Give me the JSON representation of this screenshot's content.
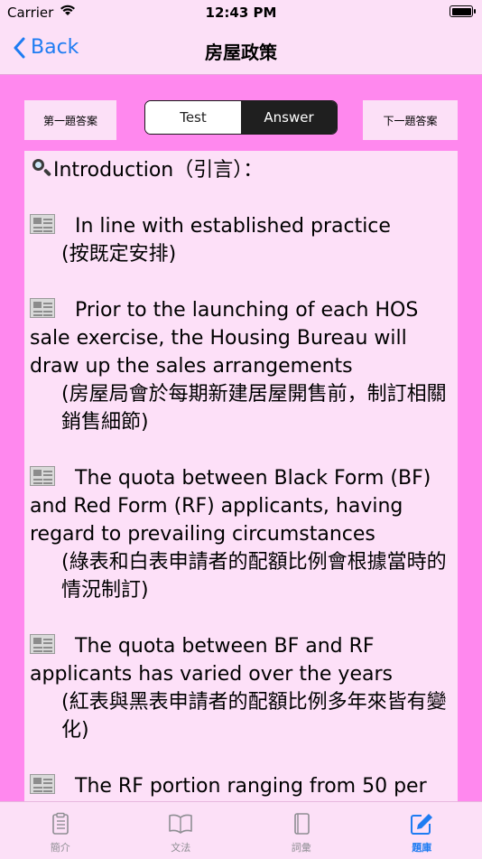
{
  "status": {
    "carrier": "Carrier",
    "time": "12:43 PM",
    "battery_level": 1.0
  },
  "nav": {
    "back_label": "Back",
    "title": "房屋政策"
  },
  "controls": {
    "prev_label": "第一題答案",
    "next_label": "下一題答案",
    "segments": [
      "Test",
      "Answer"
    ],
    "selected_segment": "Answer"
  },
  "content": {
    "intro": "Introduction（引言）：",
    "items": [
      {
        "en": "In line with established practice",
        "zh": "(按既定安排)"
      },
      {
        "en": "Prior to the launching of each HOS sale exercise, the Housing Bureau will draw up the sales arrangements",
        "zh": "(房屋局會於每期新建居屋開售前，制訂相關銷售細節)"
      },
      {
        "en": "The quota between Black Form (BF) and Red Form (RF) applicants, having regard to prevailing circumstances",
        "zh": "(綠表和白表申請者的配額比例會根據當時的情況制訂)"
      },
      {
        "en": "The quota between BF and RF applicants has varied over the years",
        "zh": "(紅表與黑表申請者的配額比例多年來皆有變化)"
      },
      {
        "en": "The RF portion ranging from 50 per",
        "zh": ""
      }
    ]
  },
  "tabs": [
    {
      "label": "簡介",
      "icon": "clipboard-icon",
      "active": false
    },
    {
      "label": "文法",
      "icon": "book-open-icon",
      "active": false
    },
    {
      "label": "詞彙",
      "icon": "book-icon",
      "active": false
    },
    {
      "label": "題庫",
      "icon": "edit-icon",
      "active": true
    }
  ],
  "colors": {
    "accent": "#1e7cf2",
    "background": "#ff88ee",
    "panel": "#fde0f8"
  }
}
